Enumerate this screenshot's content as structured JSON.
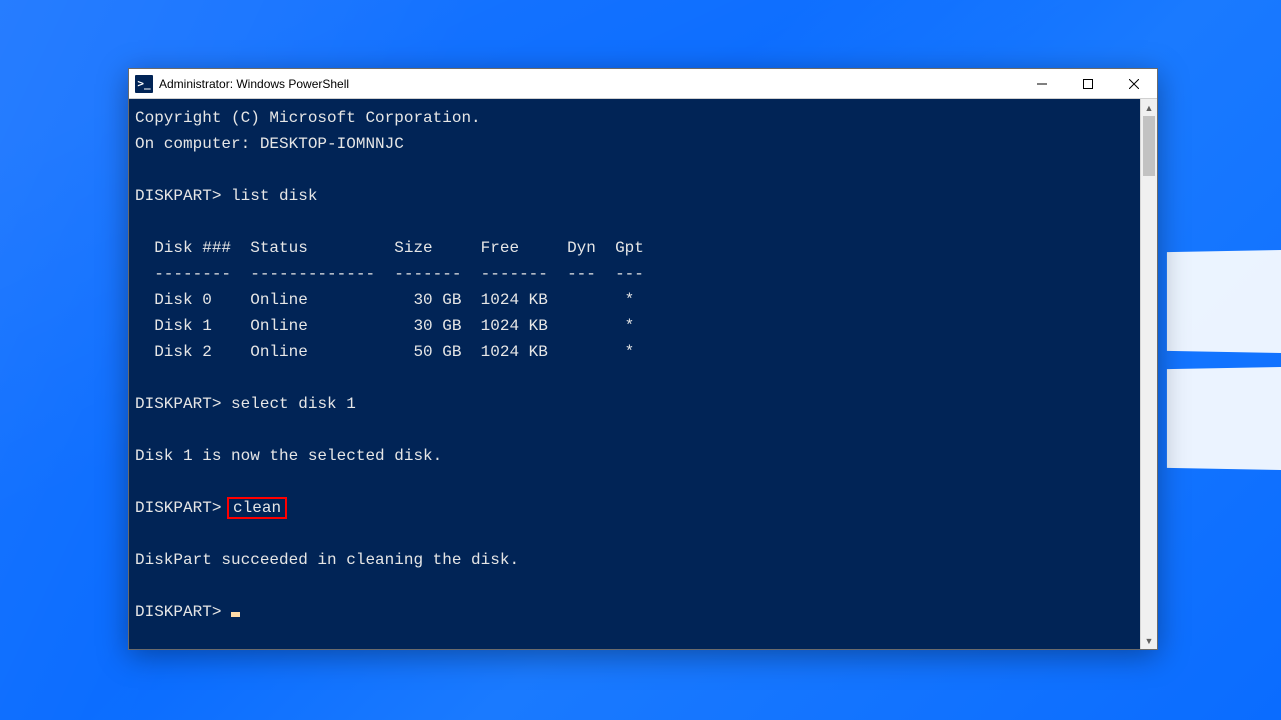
{
  "window": {
    "title": "Administrator: Windows PowerShell",
    "icon_glyph": ">_"
  },
  "terminal": {
    "copyright": "Copyright (C) Microsoft Corporation.",
    "on_computer": "On computer: DESKTOP-IOMNNJC",
    "prompt": "DISKPART>",
    "cmd_list_disk": "list disk",
    "table_header": "  Disk ###  Status         Size     Free     Dyn  Gpt",
    "table_divider": "  --------  -------------  -------  -------  ---  ---",
    "disks": [
      "  Disk 0    Online           30 GB  1024 KB        *",
      "  Disk 1    Online           30 GB  1024 KB        *",
      "  Disk 2    Online           50 GB  1024 KB        *"
    ],
    "cmd_select": "select disk 1",
    "msg_selected": "Disk 1 is now the selected disk.",
    "cmd_clean": "clean",
    "msg_cleaned": "DiskPart succeeded in cleaning the disk."
  }
}
